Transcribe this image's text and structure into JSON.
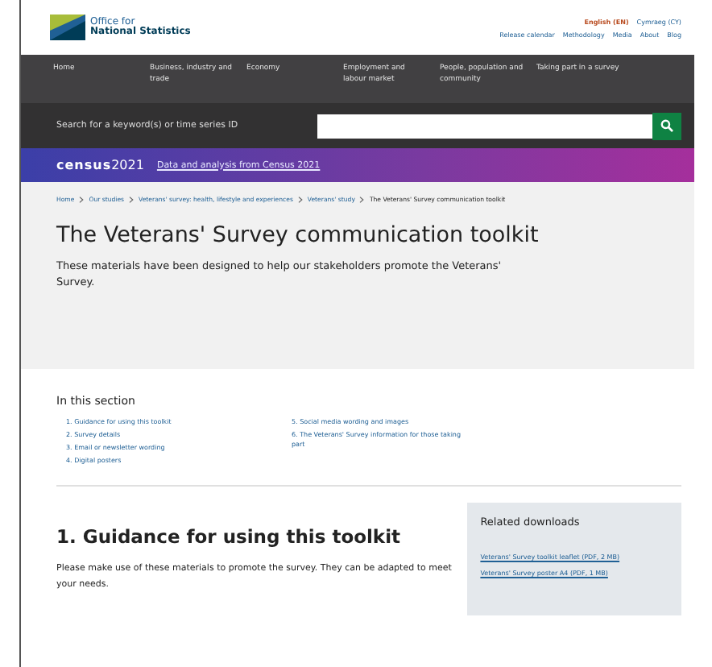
{
  "header": {
    "logo_line_1": "Office for",
    "logo_line_2": "National Statistics",
    "languages": [
      "English (EN)",
      "Cymraeg (CY)"
    ],
    "links": [
      "Release calendar",
      "Methodology",
      "Media",
      "About",
      "Blog"
    ]
  },
  "nav": [
    "Home",
    "Business, industry and trade",
    "Economy",
    "Employment and labour market",
    "People, population and community",
    "Taking part in a survey"
  ],
  "search": {
    "label": "Search for a keyword(s) or time series ID"
  },
  "census_banner": {
    "logo_word": "census",
    "logo_year": "2021",
    "link": "Data and analysis from Census 2021"
  },
  "breadcrumbs": [
    "Home",
    "Our studies",
    "Veterans' survey: health, lifestyle and experiences",
    "Veterans' study",
    "The Veterans' Survey communication toolkit"
  ],
  "title": "The Veterans' Survey communication toolkit",
  "intro": "These materials have been designed to help our stakeholders promote the Veterans' Survey.",
  "section": {
    "heading": "In this section",
    "items": [
      "1. Guidance for using this toolkit",
      "2. Survey details",
      "3. Email or newsletter wording",
      "4. Digital posters",
      "5. Social media wording and images",
      "6. The Veterans' Survey information for those taking part"
    ]
  },
  "content": {
    "heading": "1.  Guidance for using this toolkit",
    "body": "Please make use of these materials to promote the survey. They can be adapted to meet your needs."
  },
  "related": {
    "heading": "Related downloads",
    "links": [
      "Veterans' Survey toolkit leaflet (PDF, 2 MB)",
      "Veterans' Survey poster A4 (PDF, 1 MB)"
    ]
  }
}
